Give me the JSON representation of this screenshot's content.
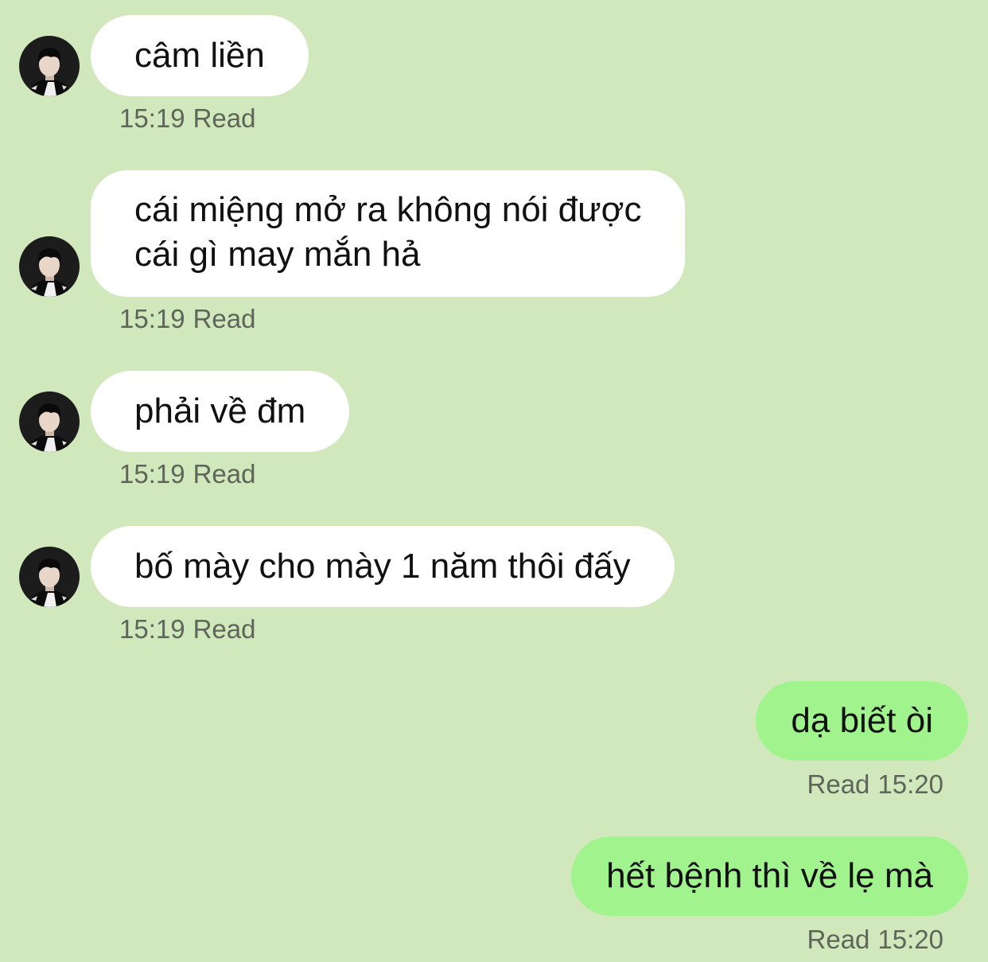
{
  "theme": {
    "background": "#d1e7bc",
    "incoming_bubble": "#ffffff",
    "outgoing_bubble": "#a1f48d",
    "text": "#111111",
    "meta_text": "#5d6658"
  },
  "messages": [
    {
      "direction": "incoming",
      "avatar_icon": "user-avatar-icon",
      "text": "câm liền",
      "time": "15:19",
      "status": "Read"
    },
    {
      "direction": "incoming",
      "avatar_icon": "user-avatar-icon",
      "lines": [
        "cái miệng mở ra không nói được",
        "cái gì may mắn hả"
      ],
      "time": "15:19",
      "status": "Read"
    },
    {
      "direction": "incoming",
      "avatar_icon": "user-avatar-icon",
      "text": "phải về đm",
      "time": "15:19",
      "status": "Read"
    },
    {
      "direction": "incoming",
      "avatar_icon": "user-avatar-icon",
      "text": "bố mày cho mày 1 năm thôi đấy",
      "time": "15:19",
      "status": "Read"
    },
    {
      "direction": "outgoing",
      "text": "dạ biết òi",
      "status": "Read",
      "time": "15:20"
    },
    {
      "direction": "outgoing",
      "text": "hết bệnh thì về lẹ mà",
      "status": "Read",
      "time": "15:20"
    }
  ]
}
